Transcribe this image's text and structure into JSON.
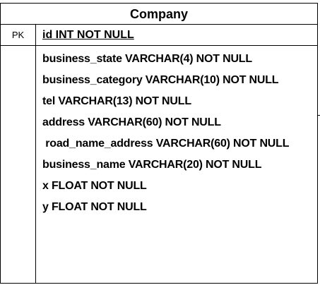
{
  "table": {
    "title": "Company",
    "pk_label": "PK",
    "pk_field": "id INT NOT NULL",
    "fields": [
      "business_state VARCHAR(4) NOT NULL",
      "business_category VARCHAR(10) NOT NULL",
      "tel VARCHAR(13) NOT NULL",
      "address VARCHAR(60) NOT NULL",
      " road_name_address VARCHAR(60) NOT NULL",
      "business_name VARCHAR(20) NOT NULL",
      "x FLOAT NOT NULL",
      "y FLOAT NOT NULL"
    ]
  }
}
